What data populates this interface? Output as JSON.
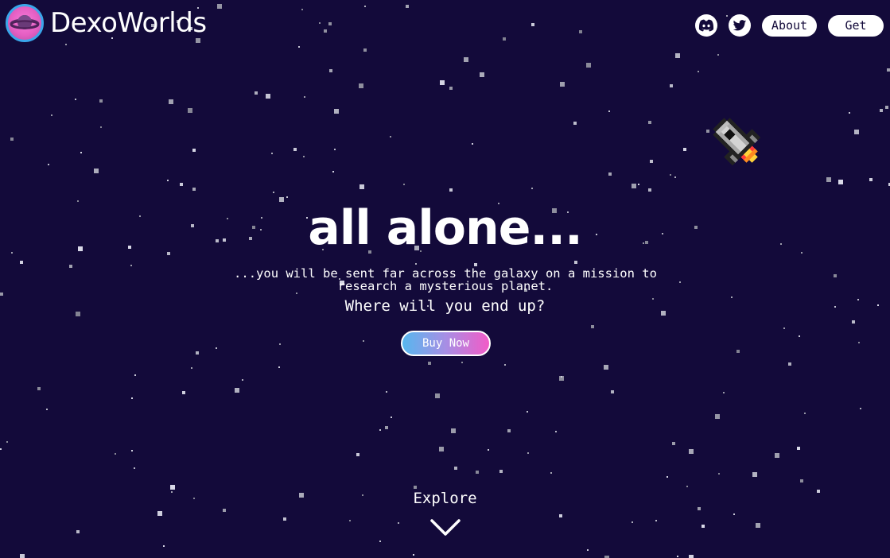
{
  "brand": {
    "name": "DexoWorlds",
    "logo_icon": "planet-icon"
  },
  "nav": {
    "discord_icon": "discord-icon",
    "twitter_icon": "twitter-icon",
    "about_label": "About",
    "get_label": "Get"
  },
  "hero": {
    "title": "all alone...",
    "subtitle": "...you will be sent far across the galaxy on a mission to research a mysterious planet.",
    "question": "Where will you end up?",
    "buy_label": "Buy Now"
  },
  "footer": {
    "explore_label": "Explore",
    "explore_icon": "chevron-down-icon"
  },
  "colors": {
    "background": "#130a3a",
    "button_gradient_start": "#57b7ee",
    "button_gradient_end": "#f25bc7",
    "logo_ring": "#3aa6ea",
    "logo_planet": "#e55fc3"
  }
}
